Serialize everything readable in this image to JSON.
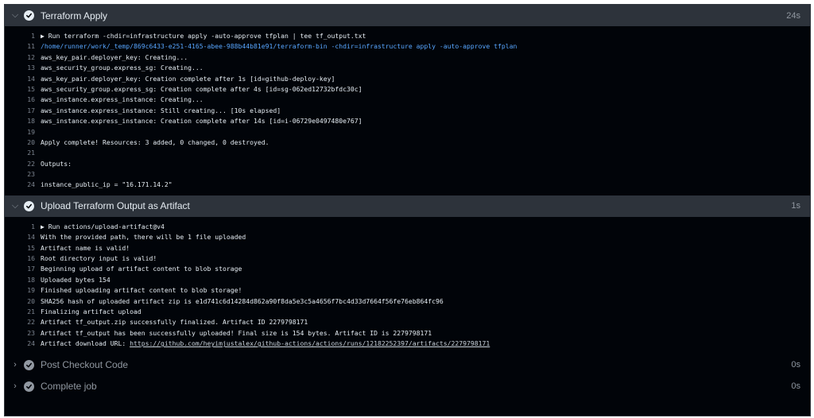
{
  "steps": [
    {
      "title": "Terraform Apply",
      "duration": "24s",
      "lines": [
        {
          "n": "1",
          "t": "▶ Run terraform -chdir=infrastructure apply -auto-approve tfplan | tee tf_output.txt"
        },
        {
          "n": "11",
          "t": "/home/runner/work/_temp/869c6433-e251-4165-abee-988b44b81e91/terraform-bin -chdir=infrastructure apply -auto-approve tfplan"
        },
        {
          "n": "12",
          "t": "aws_key_pair.deployer_key: Creating..."
        },
        {
          "n": "13",
          "t": "aws_security_group.express_sg: Creating..."
        },
        {
          "n": "14",
          "t": "aws_key_pair.deployer_key: Creation complete after 1s [id=github-deploy-key]"
        },
        {
          "n": "15",
          "t": "aws_security_group.express_sg: Creation complete after 4s [id=sg-062ed12732bfdc30c]"
        },
        {
          "n": "16",
          "t": "aws_instance.express_instance: Creating..."
        },
        {
          "n": "17",
          "t": "aws_instance.express_instance: Still creating... [10s elapsed]"
        },
        {
          "n": "18",
          "t": "aws_instance.express_instance: Creation complete after 14s [id=i-06729e0497480e767]"
        },
        {
          "n": "19",
          "t": ""
        },
        {
          "n": "20",
          "t": "Apply complete! Resources: 3 added, 0 changed, 0 destroyed."
        },
        {
          "n": "21",
          "t": ""
        },
        {
          "n": "22",
          "t": "Outputs:"
        },
        {
          "n": "23",
          "t": ""
        },
        {
          "n": "24",
          "t": "instance_public_ip = \"16.171.14.2\""
        }
      ]
    },
    {
      "title": "Upload Terraform Output as Artifact",
      "duration": "1s",
      "lines": [
        {
          "n": "1",
          "t": "▶ Run actions/upload-artifact@v4"
        },
        {
          "n": "14",
          "t": "With the provided path, there will be 1 file uploaded"
        },
        {
          "n": "15",
          "t": "Artifact name is valid!"
        },
        {
          "n": "16",
          "t": "Root directory input is valid!"
        },
        {
          "n": "17",
          "t": "Beginning upload of artifact content to blob storage"
        },
        {
          "n": "18",
          "t": "Uploaded bytes 154"
        },
        {
          "n": "19",
          "t": "Finished uploading artifact content to blob storage!"
        },
        {
          "n": "20",
          "t": "SHA256 hash of uploaded artifact zip is e1d741c6d14284d862a90f8da5e3c5a4656f7bc4d33d7664f56fe76eb864fc96"
        },
        {
          "n": "21",
          "t": "Finalizing artifact upload"
        },
        {
          "n": "22",
          "t": "Artifact tf_output.zip successfully finalized. Artifact ID 2279798171"
        },
        {
          "n": "23",
          "t": "Artifact tf_output has been successfully uploaded! Final size is 154 bytes. Artifact ID is 2279798171"
        },
        {
          "n": "24",
          "t": "Artifact download URL: ",
          "link": "https://github.com/heyimjustalex/github-actions/actions/runs/12182252397/artifacts/2279798171"
        }
      ]
    },
    {
      "title": "Post Checkout Code",
      "duration": "0s"
    },
    {
      "title": "Complete job",
      "duration": "0s"
    }
  ]
}
